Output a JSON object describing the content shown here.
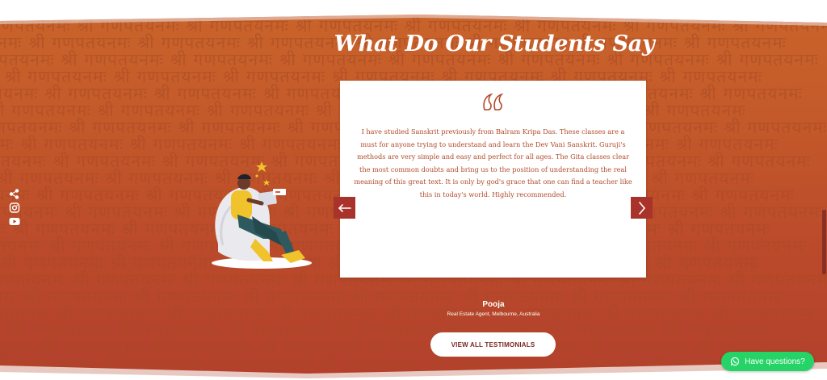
{
  "section": {
    "title": "What Do Our Students Say",
    "pattern_text": "श्री गणपतयनमः श्री गणपतयनमः श्री गणपतयनमः श्री गणपतयनमः श्री गणपतयनमः श्री गणपतयनमः श्री गणपतयनमः श्री गणपतयनमः"
  },
  "testimonial": {
    "quote": "I have studied Sanskrit previously from Balram Kripa Das. These classes are a must for anyone trying to understand and learn the Dev Vani Sanskrit. Guruji's methods are very simple and easy and perfect for all ages. The Gita classes clear the most common doubts and bring us to the position of understanding the real meaning of this great text. It is only by god's grace that one can find a teacher like this in today's world. Highly recommended.",
    "author": "Pooja",
    "role": "Real Estate Agent, Melbourne, Australia"
  },
  "controls": {
    "view_all_label": "VIEW ALL TESTIMONIALS",
    "chat_label": "Have questions?"
  },
  "icons": {
    "quote": "quote-icon",
    "prev": "arrow-left-icon",
    "next": "chevron-right-icon",
    "share": "share-icon",
    "instagram": "instagram-icon",
    "youtube": "youtube-icon",
    "whatsapp": "whatsapp-icon"
  },
  "colors": {
    "accent": "#a9332a",
    "text_on_card": "#b24a2a",
    "chat": "#25d366"
  }
}
